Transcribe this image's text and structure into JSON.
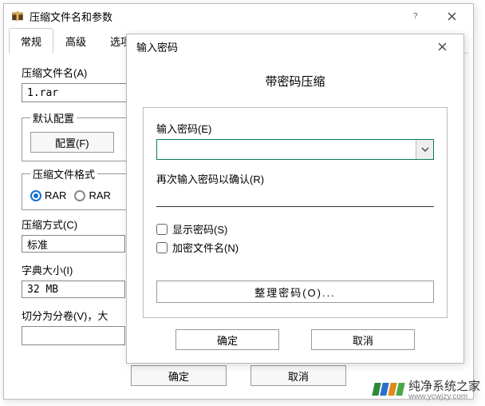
{
  "dialog1": {
    "title": "压缩文件名和参数",
    "tabs": [
      "常规",
      "高级",
      "选项"
    ],
    "filename_label": "压缩文件名(A)",
    "filename_value": "1.rar",
    "profile_group": "默认配置",
    "profile_button": "配置(F)",
    "format_group": "压缩文件格式",
    "format_rar": "RAR",
    "format_rar5": "RAR",
    "method_label": "压缩方式(C)",
    "method_value": "标准",
    "dict_label": "字典大小(I)",
    "dict_value": "32 MB",
    "split_label": "切分为分卷(V)，大",
    "ok": "确定",
    "cancel": "取消"
  },
  "dialog2": {
    "title": "输入密码",
    "heading": "带密码压缩",
    "enter_label": "输入密码(E)",
    "confirm_label": "再次输入密码以确认(R)",
    "show_pwd": "显示密码(S)",
    "encrypt_names": "加密文件名(N)",
    "manage": "整理密码(O)...",
    "ok": "确定",
    "cancel": "取消"
  },
  "watermark": {
    "line1": "纯净系统之家",
    "line2": "www.ycwjzy.com"
  }
}
